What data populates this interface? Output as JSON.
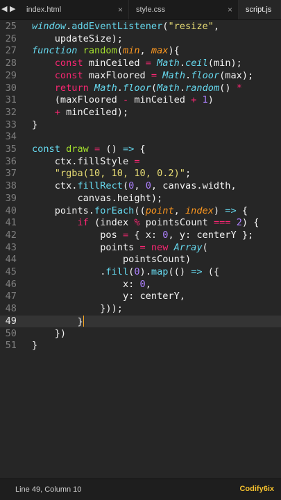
{
  "tabs": [
    {
      "label": "index.html",
      "close": "×"
    },
    {
      "label": "style.css",
      "close": "×"
    },
    {
      "label": "script.js",
      "close": ""
    }
  ],
  "nav": {
    "left": "◀",
    "right": "▶"
  },
  "editor": {
    "line_numbers": [
      "25",
      "26",
      "27",
      "28",
      "29",
      "30",
      "31",
      "32",
      "33",
      "34",
      "35",
      "36",
      "37",
      "38",
      "39",
      "40",
      "41",
      "42",
      "43",
      "44",
      "45",
      "46",
      "47",
      "48",
      "49",
      "50",
      "51"
    ],
    "current_line": "49"
  },
  "status": {
    "position": "Line 49, Column 10"
  },
  "watermark": {
    "text": "Codify6ix"
  },
  "colors": {
    "background": "#262626",
    "keyword": "#f92672",
    "string": "#e6db74",
    "number": "#ae81ff",
    "function": "#66d9ef",
    "param": "#fd971f",
    "name": "#a6e22e",
    "cursor": "#f6a623",
    "watermark": "#f5c12e"
  }
}
